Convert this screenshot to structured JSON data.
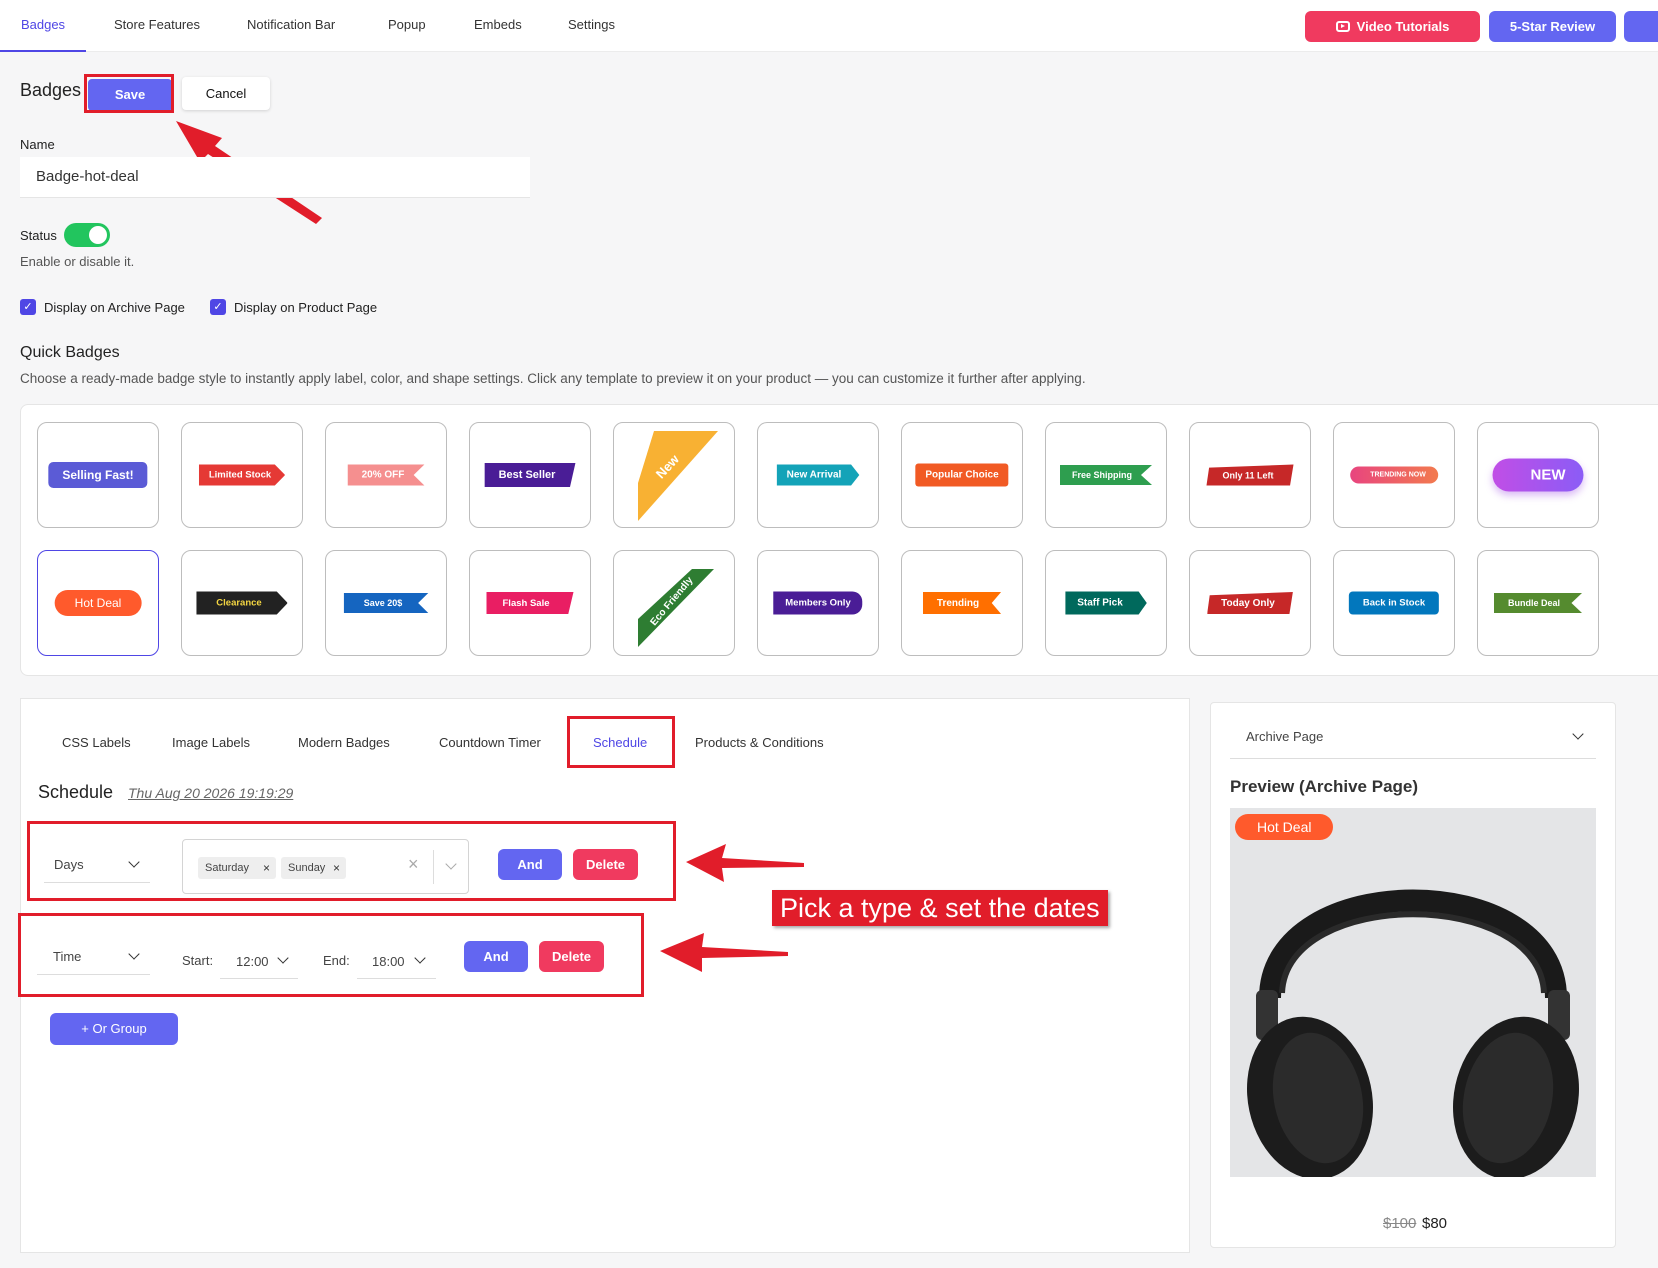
{
  "nav": {
    "tabs": [
      "Badges",
      "Store Features",
      "Notification Bar",
      "Popup",
      "Embeds",
      "Settings"
    ],
    "video_tutorials": "Video Tutorials",
    "five_star": "5-Star Review"
  },
  "header": {
    "title": "Badges",
    "save": "Save",
    "cancel": "Cancel"
  },
  "form": {
    "name_label": "Name",
    "name_value": "Badge-hot-deal",
    "status_label": "Status",
    "status_on": true,
    "status_help": "Enable or disable it.",
    "archive_label": "Display on Archive Page",
    "product_label": "Display on Product Page"
  },
  "quick": {
    "title": "Quick Badges",
    "desc": "Choose a ready-made badge style to instantly apply label, color, and shape settings. Click any template to preview it on your product — you can customize it further after applying.",
    "badges": [
      {
        "label": "Selling Fast!",
        "color": "#5b5bd6"
      },
      {
        "label": "Limited Stock",
        "color": "#e53935"
      },
      {
        "label": "20% OFF",
        "color": "#f58f8f"
      },
      {
        "label": "Best Seller",
        "color": "#4a1d96"
      },
      {
        "label": "New",
        "color": "#f8b133"
      },
      {
        "label": "New Arrival",
        "color": "#14a3b8"
      },
      {
        "label": "Popular Choice",
        "color": "#f15a24"
      },
      {
        "label": "Free Shipping",
        "color": "#2e9e4f"
      },
      {
        "label": "Only 11 Left",
        "color": "#c62828"
      },
      {
        "label": "TRENDING NOW",
        "color": "#f0507a"
      },
      {
        "label": "NEW",
        "color": "#b44be1"
      },
      {
        "label": "Hot Deal",
        "color": "#ff5a2c"
      },
      {
        "label": "Clearance",
        "color": "#222222"
      },
      {
        "label": "Save 20$",
        "color": "#1565c0"
      },
      {
        "label": "Flash Sale",
        "color": "#e91e63"
      },
      {
        "label": "Eco Friendly",
        "color": "#2e7d32"
      },
      {
        "label": "Members Only",
        "color": "#4a1d96"
      },
      {
        "label": "Trending",
        "color": "#ff6f00"
      },
      {
        "label": "Staff Pick",
        "color": "#00695c"
      },
      {
        "label": "Today Only",
        "color": "#c62828"
      },
      {
        "label": "Back in Stock",
        "color": "#0277bd"
      },
      {
        "label": "Bundle Deal",
        "color": "#558b2f"
      }
    ]
  },
  "lower": {
    "tabs": [
      "CSS Labels",
      "Image Labels",
      "Modern Badges",
      "Countdown Timer",
      "Schedule",
      "Products & Conditions"
    ],
    "schedule_title": "Schedule",
    "schedule_date": "Thu Aug 20 2026 19:19:29",
    "row1": {
      "type": "Days",
      "chips": [
        "Saturday",
        "Sunday"
      ],
      "and": "And",
      "delete": "Delete"
    },
    "row2": {
      "type": "Time",
      "start_label": "Start:",
      "start": "12:00",
      "end_label": "End:",
      "end": "18:00",
      "and": "And",
      "delete": "Delete"
    },
    "or_group": "+ Or Group"
  },
  "annotation": "Pick a type & set the dates",
  "preview": {
    "select": "Archive Page",
    "title": "Preview (Archive Page)",
    "badge": "Hot Deal",
    "old_price": "$100",
    "new_price": "$80"
  }
}
